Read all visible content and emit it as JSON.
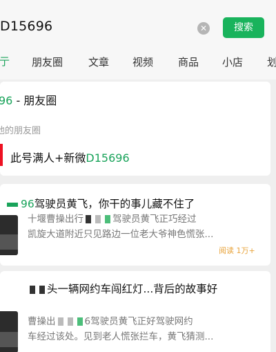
{
  "search": {
    "query": "D15696",
    "clear_icon": "clear-icon",
    "button_label": "搜索"
  },
  "tabs": [
    {
      "label": "亍"
    },
    {
      "label": "朋友圈"
    },
    {
      "label": "文章"
    },
    {
      "label": "视频"
    },
    {
      "label": "商品"
    },
    {
      "label": "小店"
    },
    {
      "label": "划"
    }
  ],
  "moments_card": {
    "title_prefix": "96",
    "title_suffix": " - 朋友圈",
    "subtitle": "他的朋友圈",
    "account_prefix": "此号满人+新微",
    "account_id": "D15696"
  },
  "articles": [
    {
      "title_prefix": "96",
      "title_main": "驾驶员黄飞，你干的事儿藏不住了",
      "desc_line1_a": "十堰曹操出行",
      "desc_line1_b": "驾驶员黄飞正巧经过",
      "desc_line2": "凯旋大道附近只见路边一位老大爷神色慌张...",
      "read_count": "阅读 1万+"
    },
    {
      "title_main": "头一辆网约车闯红灯...背后的故事好",
      "desc_line1_a": "曹操出",
      "desc_line1_b": "6驾驶员黄飞正好驾驶网约",
      "desc_line2": "车经过该处。见到老人慌张拦车，黄飞猜测..."
    }
  ],
  "colors": {
    "accent": "#19b35c",
    "read_count": "#e8a33a"
  }
}
